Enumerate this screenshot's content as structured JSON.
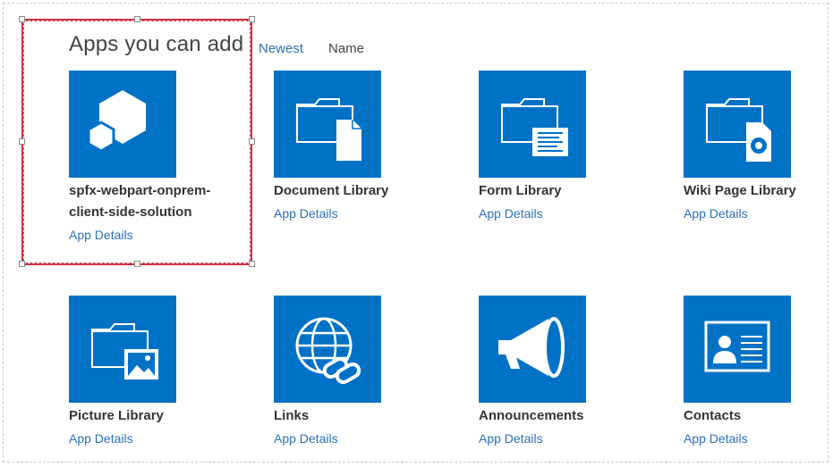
{
  "header": {
    "title": "Apps you can add"
  },
  "sort": {
    "newest": "Newest",
    "name": "Name"
  },
  "apps": [
    {
      "line1": "spfx-webpart-onprem-",
      "line2": "client-side-solution",
      "details": "App Details",
      "icon": "spfx-package-icon"
    },
    {
      "line1": "Document Library",
      "details": "App Details",
      "icon": "document-library-icon"
    },
    {
      "line1": "Form Library",
      "details": "App Details",
      "icon": "form-library-icon"
    },
    {
      "line1": "Wiki Page Library",
      "details": "App Details",
      "icon": "wiki-page-library-icon"
    },
    {
      "line1": "Picture Library",
      "details": "App Details",
      "icon": "picture-library-icon"
    },
    {
      "line1": "Links",
      "details": "App Details",
      "icon": "links-icon"
    },
    {
      "line1": "Announcements",
      "details": "App Details",
      "icon": "announcements-icon"
    },
    {
      "line1": "Contacts",
      "details": "App Details",
      "icon": "contacts-icon"
    }
  ],
  "colors": {
    "tile": "#0072c6",
    "link": "#2c70b7",
    "selection": "#d32f3f"
  }
}
